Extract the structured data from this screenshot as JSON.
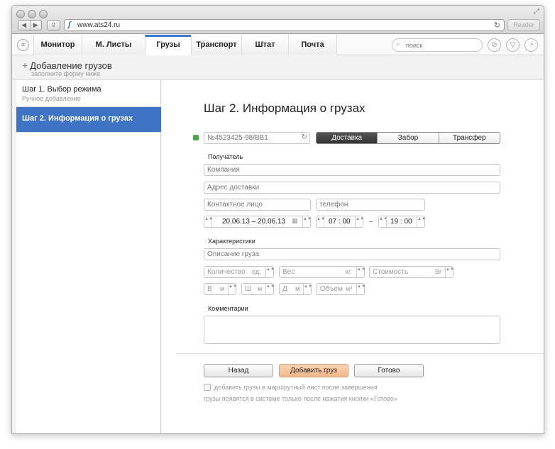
{
  "browser": {
    "url": "www.ats24.ru",
    "reader_label": "Reader",
    "back_glyph": "◀",
    "forward_glyph": "▶",
    "share_glyph": "⇪",
    "reload_glyph": "↻",
    "resize_glyph": "⤢",
    "favicon_glyph": "ʃ"
  },
  "appbar": {
    "menu_glyph": "≡",
    "tabs": [
      {
        "label": "Монитор",
        "active": false
      },
      {
        "label": "М. Листы",
        "active": false
      },
      {
        "label": "Грузы",
        "active": true
      },
      {
        "label": "Транспорт",
        "active": false
      },
      {
        "label": "Штат",
        "active": false
      },
      {
        "label": "Почта",
        "active": false
      }
    ],
    "search_placeholder": "поиск",
    "search_glyph": "⌕",
    "attach_glyph": "⊘",
    "filter_glyph": "▽",
    "gauge_glyph": "◔"
  },
  "pagehead": {
    "plus": "+",
    "title": "Добавление грузов",
    "subtitle": "заполните форму ниже"
  },
  "sidebar": {
    "items": [
      {
        "title": "Шаг 1. Выбор режима",
        "subtitle": "Ручное добавление",
        "active": false
      },
      {
        "title": "Шаг 2. Информация о грузах",
        "subtitle": "",
        "active": true
      }
    ]
  },
  "form": {
    "title": "Шаг 2. Информация о грузах",
    "tracking_placeholder": "№4523425-98/BB1",
    "modes": [
      "Доставка",
      "Забор",
      "Трансфер"
    ],
    "active_mode": "Доставка",
    "recipient_label": "Получатель",
    "company_placeholder": "Компания",
    "address_placeholder": "Адрес доставки",
    "contact_placeholder": "Контактное лицо",
    "phone_placeholder": "телефон",
    "date_range": "20.06.13 – 20.06.13",
    "calendar_glyph": "▦",
    "time_from": "07 : 00",
    "time_dash": "–",
    "time_to": "19 : 00",
    "spinner_glyph": "▲▼",
    "characteristics_label": "Характеристики",
    "description_placeholder": "Описание груза",
    "quantity_placeholder": "Количество",
    "quantity_unit": "ед.",
    "weight_placeholder": "Вес",
    "weight_unit": "кг",
    "cost_placeholder": "Стоимость",
    "cost_unit": "Br",
    "height_placeholder": "В",
    "width_placeholder": "Ш",
    "length_placeholder": "Д",
    "dim_unit": "м",
    "volume_placeholder": "Объем",
    "volume_unit": "м³",
    "comments_label": "Комментарии",
    "back_button": "Назад",
    "add_button": "Добавить груз",
    "done_button": "Готово",
    "checkbox_label": "добавить грузы в маршрутный лист после завершения",
    "note": "грузы появятся в системе только после нажатия кнопки «Готово»"
  },
  "colors": {
    "accent": "#3e74c3",
    "primary_button": "#f3b88b",
    "active_segment": "#444444",
    "status_green": "#4aa84a"
  }
}
